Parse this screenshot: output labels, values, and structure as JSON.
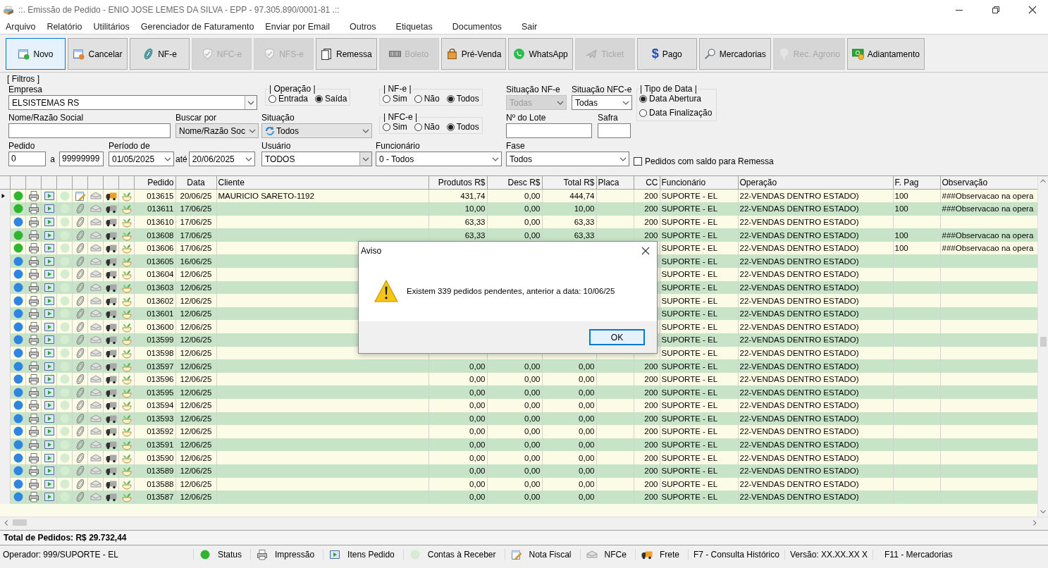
{
  "window": {
    "title": "::. Emissão de Pedido - ENIO JOSE LEMES DA SILVA - EPP - 97.305.890/0001-81 .::"
  },
  "menu": [
    "Arquivo",
    "Relatório",
    "Utilitários",
    "Gerenciador de Faturamento",
    "Enviar por Email",
    "Outros",
    "Etiquetas",
    "Documentos",
    "Sair"
  ],
  "toolbar": [
    {
      "label": "Novo",
      "kind": "new",
      "focused": true,
      "disabled": false
    },
    {
      "label": "Cancelar",
      "kind": "cancel",
      "focused": false,
      "disabled": false
    },
    {
      "label": "NF-e",
      "kind": "nfe",
      "focused": false,
      "disabled": false
    },
    {
      "label": "NFC-e",
      "kind": "shield",
      "focused": false,
      "disabled": true
    },
    {
      "label": "NFS-e",
      "kind": "shield",
      "focused": false,
      "disabled": true
    },
    {
      "label": "Remessa",
      "kind": "pages",
      "focused": false,
      "disabled": false
    },
    {
      "label": "Boleto",
      "kind": "barcode",
      "focused": false,
      "disabled": true
    },
    {
      "label": "Pré-Venda",
      "kind": "bag",
      "focused": false,
      "disabled": false
    },
    {
      "label": "WhatsApp",
      "kind": "chat",
      "focused": false,
      "disabled": false
    },
    {
      "label": "Ticket",
      "kind": "plane",
      "focused": false,
      "disabled": true
    },
    {
      "label": "Pago",
      "kind": "glyph",
      "glyph": "$",
      "focused": false,
      "disabled": false
    },
    {
      "label": "Mercadorias",
      "kind": "search",
      "focused": false,
      "disabled": false
    },
    {
      "label": "Rec. Agrono",
      "kind": "tree",
      "focused": false,
      "disabled": true
    },
    {
      "label": "Adiantamento",
      "kind": "money",
      "focused": false,
      "disabled": false
    }
  ],
  "filters": {
    "title": "[ Filtros ]",
    "empresa": {
      "label": "Empresa",
      "value": "ELSISTEMAS RS"
    },
    "operacao": {
      "title": "| Operação |",
      "options": [
        {
          "label": "Entrada",
          "selected": false
        },
        {
          "label": "Saída",
          "selected": true
        }
      ]
    },
    "nfe": {
      "title": "| NF-e |",
      "options": [
        {
          "label": "Sim",
          "selected": false
        },
        {
          "label": "Não",
          "selected": false
        },
        {
          "label": "Todos",
          "selected": true
        }
      ]
    },
    "situacao_nfe": {
      "label": "Situação NF-e",
      "value": "Todas",
      "disabled": true
    },
    "situacao_nfce": {
      "label": "Situação NFC-e",
      "value": "Todas",
      "disabled": false
    },
    "tipo_data": {
      "title": "| Tipo de Data |",
      "options": [
        {
          "label": "Data Abertura",
          "selected": true
        },
        {
          "label": "Data Finalização",
          "selected": false
        }
      ]
    },
    "nome": {
      "label": "Nome/Razão Social"
    },
    "buscar_por": {
      "label": "Buscar por",
      "value": "Nome/Razão Soc"
    },
    "situacao": {
      "label": "Situação",
      "value": "Todos"
    },
    "nfce": {
      "title": "| NFC-e |",
      "options": [
        {
          "label": "Sim",
          "selected": false
        },
        {
          "label": "Não",
          "selected": false
        },
        {
          "label": "Todos",
          "selected": true
        }
      ]
    },
    "lote": {
      "label": "Nº do Lote"
    },
    "safra": {
      "label": "Safra"
    },
    "pedido": {
      "label": "Pedido",
      "from": "0",
      "separator": "a",
      "to": "99999999"
    },
    "periodo": {
      "label": "Período de",
      "from": "01/05/2025",
      "separator": "até",
      "to": "20/06/2025"
    },
    "usuario": {
      "label": "Usuário",
      "value": "TODOS"
    },
    "funcionario": {
      "label": "Funcionário",
      "value": "0 - Todos"
    },
    "fase": {
      "label": "Fase",
      "value": "Todos"
    },
    "saldo_remessa": {
      "label": "Pedidos com saldo para Remessa",
      "checked": false
    }
  },
  "table": {
    "columns": [
      "Pedido",
      "Data",
      "Cliente",
      "Produtos R$",
      "Desc R$",
      "Total R$",
      "Placa",
      "CC",
      "Funcionário",
      "Operação",
      "F. Pag",
      "Observação"
    ],
    "rows": [
      {
        "selected": true,
        "color": "#2fb52f",
        "invoiced": true,
        "pedido": "013615",
        "data": "20/06/25",
        "cliente": "MAURICIO SARETO-1192",
        "produtos": "431,74",
        "desc": "0,00",
        "total": "444,74",
        "cc": "200",
        "funcionario": "SUPORTE - EL",
        "operacao": "22-VENDAS DENTRO ESTADO)",
        "f_pag": "100",
        "observacao": "###Observacao na opera"
      },
      {
        "selected": false,
        "color": "#2fb52f",
        "invoiced": false,
        "pedido": "013611",
        "data": "17/06/25",
        "produtos": "10,00",
        "desc": "0,00",
        "total": "10,00",
        "cc": "200",
        "funcionario": "SUPORTE - EL",
        "operacao": "22-VENDAS DENTRO ESTADO)",
        "f_pag": "100",
        "observacao": "###Observacao na opera"
      },
      {
        "selected": false,
        "color": "#2f86e0",
        "invoiced": false,
        "pedido": "013610",
        "data": "17/06/25",
        "produtos": "63,33",
        "desc": "0,00",
        "total": "63,33",
        "cc": "200",
        "funcionario": "SUPORTE - EL",
        "operacao": "22-VENDAS DENTRO ESTADO)"
      },
      {
        "selected": false,
        "color": "#2fb52f",
        "invoiced": false,
        "pedido": "013608",
        "data": "17/06/25",
        "produtos": "63,33",
        "desc": "0,00",
        "total": "63,33",
        "cc": "200",
        "funcionario": "SUPORTE - EL",
        "operacao": "22-VENDAS DENTRO ESTADO)",
        "f_pag": "100",
        "observacao": "###Observacao na opera"
      },
      {
        "selected": false,
        "color": "#2fb52f",
        "invoiced": false,
        "pedido": "013606",
        "data": "17/06/25",
        "funcionario": "SUPORTE - EL",
        "operacao": "22-VENDAS DENTRO ESTADO)",
        "f_pag": "100",
        "observacao": "###Observacao na opera"
      },
      {
        "selected": false,
        "color": "#2f86e0",
        "invoiced": false,
        "pedido": "013605",
        "data": "16/06/25",
        "funcionario": "SUPORTE - EL",
        "operacao": "22-VENDAS DENTRO ESTADO)"
      },
      {
        "selected": false,
        "color": "#2f86e0",
        "invoiced": false,
        "pedido": "013604",
        "data": "12/06/25",
        "funcionario": "SUPORTE - EL",
        "operacao": "22-VENDAS DENTRO ESTADO)"
      },
      {
        "selected": false,
        "color": "#2f86e0",
        "invoiced": false,
        "pedido": "013603",
        "data": "12/06/25",
        "funcionario": "SUPORTE - EL",
        "operacao": "22-VENDAS DENTRO ESTADO)"
      },
      {
        "selected": false,
        "color": "#2f86e0",
        "invoiced": false,
        "pedido": "013602",
        "data": "12/06/25",
        "funcionario": "SUPORTE - EL",
        "operacao": "22-VENDAS DENTRO ESTADO)"
      },
      {
        "selected": false,
        "color": "#2f86e0",
        "invoiced": false,
        "pedido": "013601",
        "data": "12/06/25",
        "funcionario": "SUPORTE - EL",
        "operacao": "22-VENDAS DENTRO ESTADO)"
      },
      {
        "selected": false,
        "color": "#2f86e0",
        "invoiced": false,
        "pedido": "013600",
        "data": "12/06/25",
        "funcionario": "SUPORTE - EL",
        "operacao": "22-VENDAS DENTRO ESTADO)"
      },
      {
        "selected": false,
        "color": "#2f86e0",
        "invoiced": false,
        "pedido": "013599",
        "data": "12/06/25",
        "funcionario": "SUPORTE - EL",
        "operacao": "22-VENDAS DENTRO ESTADO)"
      },
      {
        "selected": false,
        "color": "#2f86e0",
        "invoiced": false,
        "pedido": "013598",
        "data": "12/06/25",
        "funcionario": "SUPORTE - EL",
        "operacao": "22-VENDAS DENTRO ESTADO)"
      },
      {
        "selected": false,
        "color": "#2f86e0",
        "invoiced": false,
        "pedido": "013597",
        "data": "12/06/25",
        "produtos": "0,00",
        "desc": "0,00",
        "total": "0,00",
        "cc": "200",
        "funcionario": "SUPORTE - EL",
        "operacao": "22-VENDAS DENTRO ESTADO)"
      },
      {
        "selected": false,
        "color": "#2f86e0",
        "invoiced": false,
        "pedido": "013596",
        "data": "12/06/25",
        "produtos": "0,00",
        "desc": "0,00",
        "total": "0,00",
        "cc": "200",
        "funcionario": "SUPORTE - EL",
        "operacao": "22-VENDAS DENTRO ESTADO)"
      },
      {
        "selected": false,
        "color": "#2f86e0",
        "invoiced": false,
        "pedido": "013595",
        "data": "12/06/25",
        "produtos": "0,00",
        "desc": "0,00",
        "total": "0,00",
        "cc": "200",
        "funcionario": "SUPORTE - EL",
        "operacao": "22-VENDAS DENTRO ESTADO)"
      },
      {
        "selected": false,
        "color": "#2f86e0",
        "invoiced": false,
        "pedido": "013594",
        "data": "12/06/25",
        "produtos": "0,00",
        "desc": "0,00",
        "total": "0,00",
        "cc": "200",
        "funcionario": "SUPORTE - EL",
        "operacao": "22-VENDAS DENTRO ESTADO)"
      },
      {
        "selected": false,
        "color": "#2f86e0",
        "invoiced": false,
        "pedido": "013593",
        "data": "12/06/25",
        "produtos": "0,00",
        "desc": "0,00",
        "total": "0,00",
        "cc": "200",
        "funcionario": "SUPORTE - EL",
        "operacao": "22-VENDAS DENTRO ESTADO)"
      },
      {
        "selected": false,
        "color": "#2f86e0",
        "invoiced": false,
        "pedido": "013592",
        "data": "12/06/25",
        "produtos": "0,00",
        "desc": "0,00",
        "total": "0,00",
        "cc": "200",
        "funcionario": "SUPORTE - EL",
        "operacao": "22-VENDAS DENTRO ESTADO)"
      },
      {
        "selected": false,
        "color": "#2f86e0",
        "invoiced": false,
        "pedido": "013591",
        "data": "12/06/25",
        "produtos": "0,00",
        "desc": "0,00",
        "total": "0,00",
        "cc": "200",
        "funcionario": "SUPORTE - EL",
        "operacao": "22-VENDAS DENTRO ESTADO)"
      },
      {
        "selected": false,
        "color": "#2f86e0",
        "invoiced": false,
        "pedido": "013590",
        "data": "12/06/25",
        "produtos": "0,00",
        "desc": "0,00",
        "total": "0,00",
        "cc": "200",
        "funcionario": "SUPORTE - EL",
        "operacao": "22-VENDAS DENTRO ESTADO)"
      },
      {
        "selected": false,
        "color": "#2f86e0",
        "invoiced": false,
        "pedido": "013589",
        "data": "12/06/25",
        "produtos": "0,00",
        "desc": "0,00",
        "total": "0,00",
        "cc": "200",
        "funcionario": "SUPORTE - EL",
        "operacao": "22-VENDAS DENTRO ESTADO)"
      },
      {
        "selected": false,
        "color": "#2f86e0",
        "invoiced": false,
        "pedido": "013588",
        "data": "12/06/25",
        "produtos": "0,00",
        "desc": "0,00",
        "total": "0,00",
        "cc": "200",
        "funcionario": "SUPORTE - EL",
        "operacao": "22-VENDAS DENTRO ESTADO)"
      },
      {
        "selected": false,
        "color": "#2f86e0",
        "invoiced": false,
        "pedido": "013587",
        "data": "12/06/25",
        "produtos": "0,00",
        "desc": "0,00",
        "total": "0,00",
        "cc": "200",
        "funcionario": "SUPORTE - EL",
        "operacao": "22-VENDAS DENTRO ESTADO)"
      }
    ]
  },
  "dialog": {
    "title": "Aviso",
    "message": "Existem 339 pedidos pendentes, anterior a data: 10/06/25",
    "button": "OK"
  },
  "total": "Total de Pedidos: R$ 29.732,44",
  "status_bar": {
    "operator": "Operador: 999/SUPORTE - EL",
    "legend": [
      {
        "label": "Status",
        "kind": "dot"
      },
      {
        "label": "Impressão",
        "kind": "printer"
      },
      {
        "label": "Itens Pedido",
        "kind": "itens"
      },
      {
        "label": "Contas à Receber",
        "kind": "contas"
      },
      {
        "label": "Nota Fiscal",
        "kind": "pencil"
      },
      {
        "label": "NFCe",
        "kind": "tray"
      },
      {
        "label": "Frete",
        "kind": "truck"
      }
    ],
    "shortcuts": [
      "F7 - Consulta Histórico",
      "Versão: XX.XX.XX X",
      "F11 - Mercadorias"
    ]
  }
}
